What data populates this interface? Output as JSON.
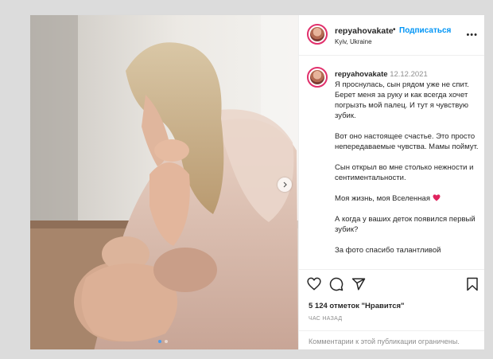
{
  "post": {
    "username": "repyahovakate",
    "follow_label": "Подписаться",
    "location": "Kyiv, Ukraine",
    "caption_date": "12.12.2021",
    "caption_paragraphs": [
      "Я проснулась, сын рядом уже не спит. Берет меня за руку и как всегда хочет погрызть мой палец. И тут я чувствую зубик.",
      "Вот оно настоящее счастье. Это просто непередаваемые чувства. Мамы поймут.",
      "Сын открыл во мне столько нежности и сентиментальности.",
      "Моя жизнь, моя Вселенная",
      "А когда у ваших деток появился первый зубик?",
      "За фото спасибо талантливой"
    ],
    "likes": "5 124 отметок \"Нравится\"",
    "time_ago": "ЧАС НАЗАД",
    "comments_disabled": "Комментарии к этой публикации ограничены."
  },
  "icons": {
    "more": "more-horizontal-icon",
    "heart": "heart-icon",
    "comment": "comment-icon",
    "share": "share-icon",
    "save": "bookmark-icon",
    "next": "chevron-right-icon",
    "emoji": "red-heart-emoji"
  },
  "colors": {
    "accent": "#0095f6",
    "avatar_ring": "#e1306c",
    "heart_emoji": "#e0245e"
  },
  "carousel": {
    "current": 1,
    "total": 2
  }
}
